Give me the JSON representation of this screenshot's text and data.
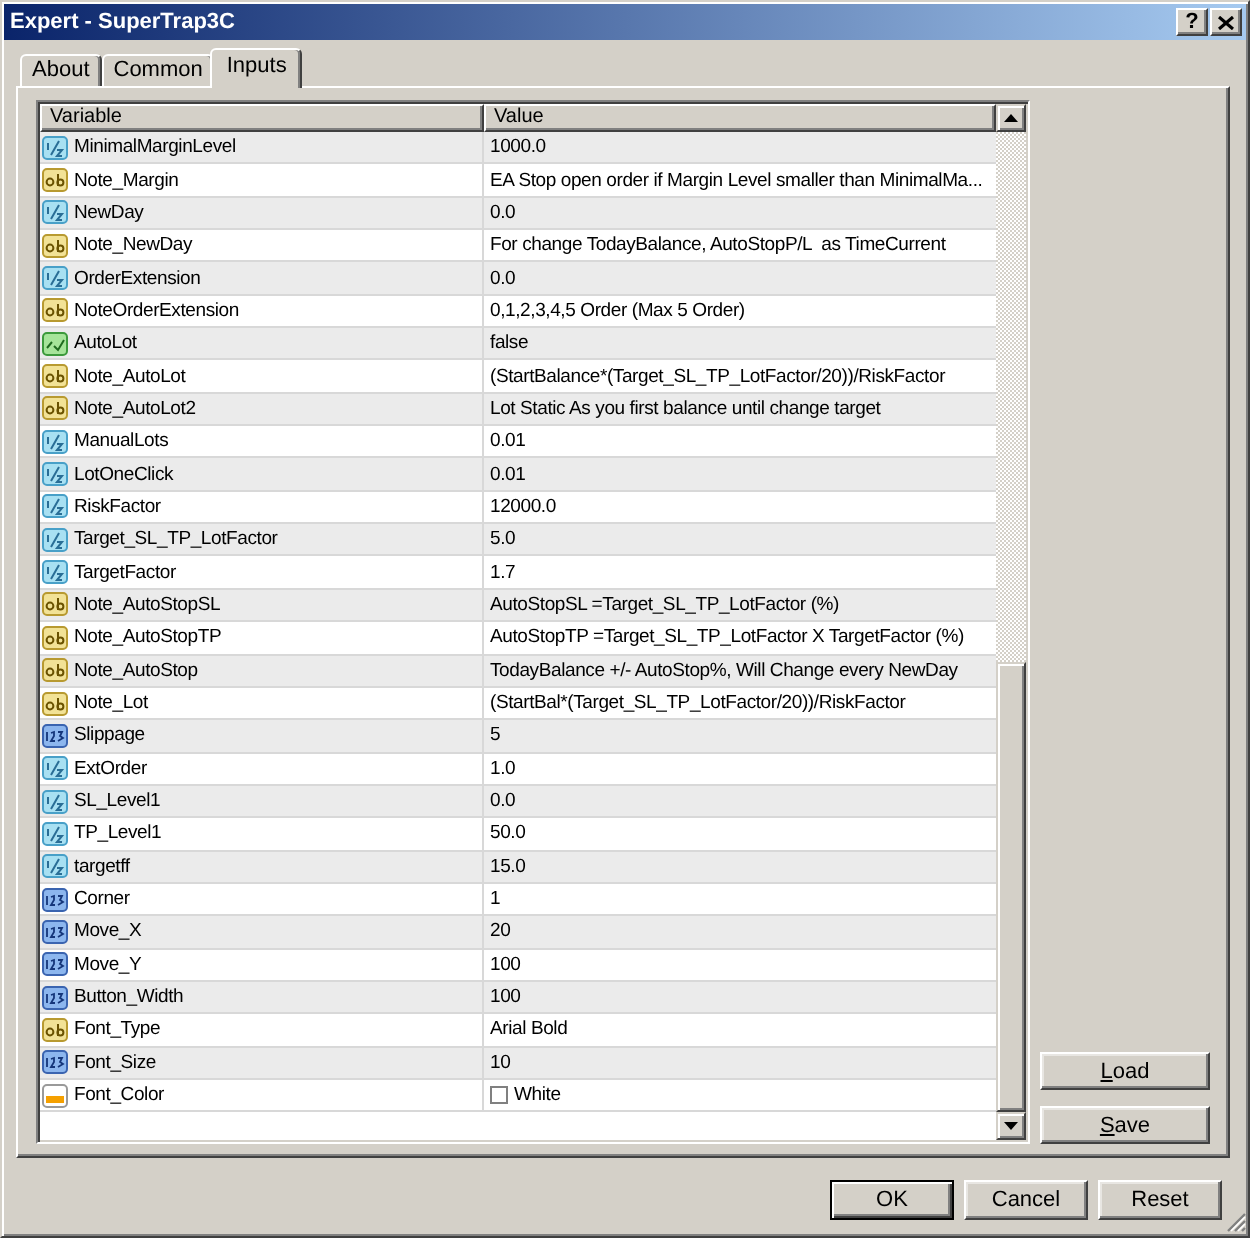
{
  "window": {
    "title": "Expert - SuperTrap3C",
    "help_button": "?"
  },
  "tabs": [
    {
      "label": "About",
      "selected": false
    },
    {
      "label": "Common",
      "selected": false
    },
    {
      "label": "Inputs",
      "selected": true
    }
  ],
  "table": {
    "columns": [
      "Variable",
      "Value"
    ],
    "rows": [
      {
        "kind": "double",
        "variable": "MinimalMarginLevel",
        "value": "1000.0"
      },
      {
        "kind": "string",
        "variable": "Note_Margin",
        "value": "EA Stop open order if Margin Level smaller than MinimalMa..."
      },
      {
        "kind": "double",
        "variable": "NewDay",
        "value": "0.0"
      },
      {
        "kind": "string",
        "variable": "Note_NewDay",
        "value": "For change TodayBalance, AutoStopP/L  as TimeCurrent"
      },
      {
        "kind": "double",
        "variable": "OrderExtension",
        "value": "0.0"
      },
      {
        "kind": "string",
        "variable": "NoteOrderExtension",
        "value": "0,1,2,3,4,5 Order (Max 5 Order)"
      },
      {
        "kind": "bool",
        "variable": "AutoLot",
        "value": "false"
      },
      {
        "kind": "string",
        "variable": "Note_AutoLot",
        "value": "(StartBalance*(Target_SL_TP_LotFactor/20))/RiskFactor"
      },
      {
        "kind": "string",
        "variable": "Note_AutoLot2",
        "value": "Lot Static As you first balance until change target"
      },
      {
        "kind": "double",
        "variable": "ManualLots",
        "value": "0.01"
      },
      {
        "kind": "double",
        "variable": "LotOneClick",
        "value": "0.01"
      },
      {
        "kind": "double",
        "variable": "RiskFactor",
        "value": "12000.0"
      },
      {
        "kind": "double",
        "variable": "Target_SL_TP_LotFactor",
        "value": "5.0"
      },
      {
        "kind": "double",
        "variable": "TargetFactor",
        "value": "1.7"
      },
      {
        "kind": "string",
        "variable": "Note_AutoStopSL",
        "value": "AutoStopSL =Target_SL_TP_LotFactor (%)"
      },
      {
        "kind": "string",
        "variable": "Note_AutoStopTP",
        "value": "AutoStopTP =Target_SL_TP_LotFactor X TargetFactor (%)"
      },
      {
        "kind": "string",
        "variable": "Note_AutoStop",
        "value": "TodayBalance +/- AutoStop%, Will Change every NewDay"
      },
      {
        "kind": "string",
        "variable": "Note_Lot",
        "value": "(StartBal*(Target_SL_TP_LotFactor/20))/RiskFactor"
      },
      {
        "kind": "int",
        "variable": "Slippage",
        "value": "5"
      },
      {
        "kind": "double",
        "variable": "ExtOrder",
        "value": "1.0"
      },
      {
        "kind": "double",
        "variable": "SL_Level1",
        "value": "0.0"
      },
      {
        "kind": "double",
        "variable": "TP_Level1",
        "value": "50.0"
      },
      {
        "kind": "double",
        "variable": "targetff",
        "value": "15.0"
      },
      {
        "kind": "int",
        "variable": "Corner",
        "value": "1"
      },
      {
        "kind": "int",
        "variable": "Move_X",
        "value": "20"
      },
      {
        "kind": "int",
        "variable": "Move_Y",
        "value": "100"
      },
      {
        "kind": "int",
        "variable": "Button_Width",
        "value": "100"
      },
      {
        "kind": "string",
        "variable": "Font_Type",
        "value": "Arial Bold"
      },
      {
        "kind": "int",
        "variable": "Font_Size",
        "value": "10"
      },
      {
        "kind": "color",
        "variable": "Font_Color",
        "value": "White",
        "color": "#ffffff"
      }
    ]
  },
  "side_buttons": [
    "Load",
    "Save"
  ],
  "buttons": [
    {
      "label": "OK",
      "default": true
    },
    {
      "label": "Cancel",
      "default": false
    },
    {
      "label": "Reset",
      "default": false
    }
  ]
}
